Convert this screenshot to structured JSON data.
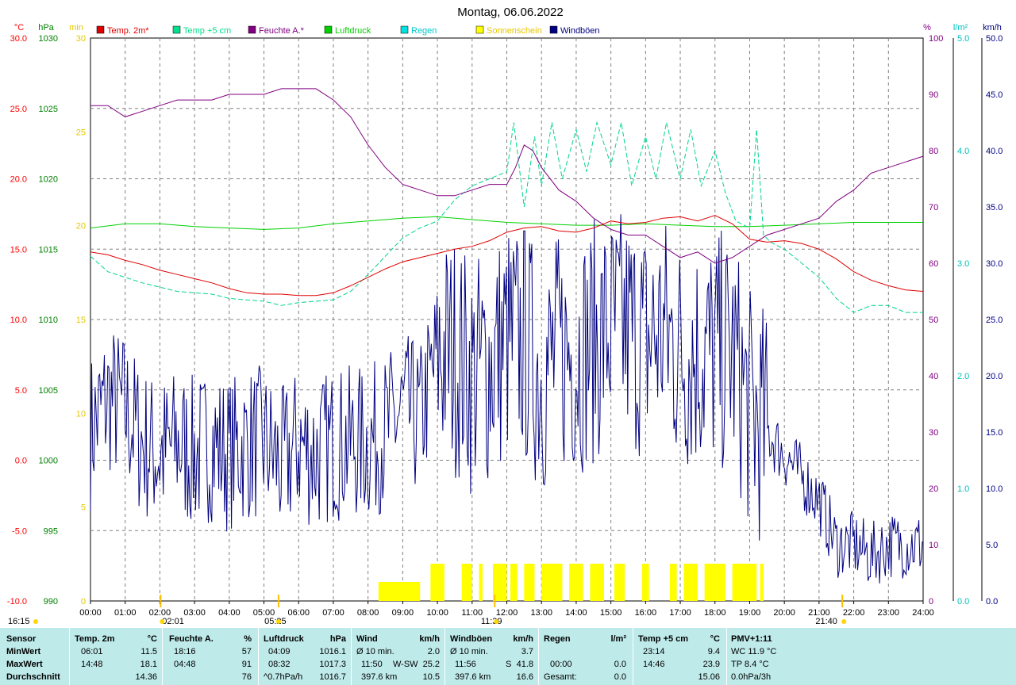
{
  "chart_data": {
    "type": "line",
    "title": "Montag, 06.06.2022",
    "x": {
      "min": 0,
      "max": 24,
      "ticks": [
        "00:00",
        "01:00",
        "02:00",
        "03:00",
        "04:00",
        "05:00",
        "06:00",
        "07:00",
        "08:00",
        "09:00",
        "10:00",
        "11:00",
        "12:00",
        "13:00",
        "14:00",
        "15:00",
        "16:00",
        "17:00",
        "18:00",
        "19:00",
        "20:00",
        "21:00",
        "22:00",
        "23:00",
        "24:00"
      ]
    },
    "axes": {
      "temp": {
        "unit": "°C",
        "min": -10,
        "max": 30,
        "ticks": [
          "-10.0",
          "-5.0",
          "0.0",
          "5.0",
          "10.0",
          "15.0",
          "20.0",
          "25.0",
          "30.0"
        ],
        "color": "#ff0000"
      },
      "pressure": {
        "unit": "hPa",
        "min": 990,
        "max": 1030,
        "ticks": [
          "990",
          "995",
          "1000",
          "1005",
          "1010",
          "1015",
          "1020",
          "1025",
          "1030"
        ],
        "color": "#008000"
      },
      "sunmin": {
        "unit": "min",
        "min": 0,
        "max": 30,
        "ticks": [
          "0",
          "5",
          "10",
          "15",
          "20",
          "25",
          "30"
        ],
        "color": "#e6c800"
      },
      "humidity": {
        "unit": "%",
        "min": 0,
        "max": 100,
        "ticks": [
          "0",
          "10",
          "20",
          "30",
          "40",
          "50",
          "60",
          "70",
          "80",
          "90",
          "100"
        ],
        "color": "#800080"
      },
      "rain": {
        "unit": "l/m²",
        "min": 0,
        "max": 5,
        "ticks": [
          "0.0",
          "1.0",
          "2.0",
          "3.0",
          "4.0",
          "5.0"
        ],
        "color": "#00c0c0"
      },
      "wind": {
        "unit": "km/h",
        "min": 0,
        "max": 50,
        "ticks": [
          "0.0",
          "5.0",
          "10.0",
          "15.0",
          "20.0",
          "25.0",
          "30.0",
          "35.0",
          "40.0",
          "45.0",
          "50.0"
        ],
        "color": "#000080"
      }
    },
    "legend": [
      {
        "name": "Temp. 2m*",
        "color": "#e00000"
      },
      {
        "name": "Temp +5 cm",
        "color": "#00e08c"
      },
      {
        "name": "Feuchte A.*",
        "color": "#800080"
      },
      {
        "name": "Luftdruck",
        "color": "#00d000"
      },
      {
        "name": "Regen",
        "color": "#00e0e0"
      },
      {
        "name": "Sonnenschein",
        "color": "#ffff00"
      },
      {
        "name": "Windböen",
        "color": "#000080"
      }
    ],
    "grid": true,
    "series": [
      {
        "name": "Temp. 2m*",
        "axis": "temp",
        "color": "#e00000",
        "x": [
          0,
          0.5,
          1,
          1.5,
          2,
          2.5,
          3,
          3.5,
          4,
          4.5,
          5,
          5.5,
          6,
          6.5,
          7,
          7.5,
          8,
          8.5,
          9,
          9.5,
          10,
          10.5,
          11,
          11.5,
          12,
          12.5,
          13,
          13.5,
          14,
          14.5,
          15,
          15.5,
          16,
          16.5,
          17,
          17.5,
          18,
          18.5,
          19,
          19.5,
          20,
          20.5,
          21,
          21.5,
          22,
          22.5,
          23,
          23.5,
          24
        ],
        "y": [
          14.8,
          14.6,
          14.2,
          13.9,
          13.5,
          13.2,
          12.9,
          12.6,
          12.2,
          11.9,
          11.8,
          11.8,
          11.7,
          11.7,
          11.9,
          12.4,
          13.0,
          13.6,
          14.1,
          14.4,
          14.7,
          15.0,
          15.2,
          15.6,
          16.2,
          16.5,
          16.6,
          16.3,
          16.2,
          16.5,
          17.0,
          16.8,
          16.9,
          17.2,
          17.3,
          17.0,
          17.4,
          16.8,
          15.7,
          15.5,
          15.6,
          15.4,
          15.0,
          14.3,
          13.4,
          12.8,
          12.4,
          12.1,
          12.0
        ]
      },
      {
        "name": "Temp +5 cm",
        "axis": "temp",
        "color": "#00d48c",
        "dashed": true,
        "x": [
          0,
          0.5,
          1,
          1.5,
          2,
          2.5,
          3,
          3.5,
          4,
          4.5,
          5,
          5.5,
          6,
          6.5,
          7,
          7.5,
          8,
          8.5,
          9,
          9.5,
          10,
          10.5,
          11,
          11.5,
          12,
          12.2,
          12.5,
          12.8,
          13,
          13.3,
          13.6,
          14,
          14.3,
          14.6,
          15,
          15.3,
          15.6,
          16,
          16.3,
          16.6,
          17,
          17.3,
          17.6,
          18,
          18.3,
          18.6,
          19,
          19.2,
          19.4,
          19.6,
          20,
          20.5,
          21,
          21.5,
          22,
          22.5,
          23,
          23.5,
          24
        ],
        "y": [
          14.5,
          13.4,
          13.0,
          12.6,
          12.3,
          12.0,
          11.9,
          11.8,
          11.5,
          11.4,
          11.3,
          11.0,
          11.2,
          11.3,
          11.4,
          12.0,
          13.2,
          14.5,
          15.8,
          16.5,
          17.0,
          18.5,
          19.5,
          20.0,
          20.5,
          24.0,
          18.0,
          23.0,
          19.5,
          24.0,
          20.0,
          23.5,
          20.5,
          24.0,
          21.0,
          24.0,
          19.5,
          23.0,
          20.0,
          24.0,
          20.0,
          23.5,
          19.5,
          22.0,
          19.0,
          17.0,
          16.5,
          23.5,
          16.0,
          15.5,
          15.0,
          14.0,
          13.0,
          11.5,
          10.5,
          11.0,
          11.0,
          10.5,
          10.5
        ]
      },
      {
        "name": "Feuchte A.*",
        "axis": "humidity",
        "color": "#800080",
        "x": [
          0,
          0.5,
          1,
          1.5,
          2,
          2.5,
          3,
          3.5,
          4,
          4.5,
          5,
          5.5,
          6,
          6.5,
          7,
          7.5,
          8,
          8.5,
          9,
          9.5,
          10,
          10.5,
          11,
          11.5,
          12,
          12.25,
          12.5,
          12.75,
          13,
          13.5,
          14,
          14.5,
          15,
          15.5,
          16,
          16.5,
          17,
          17.5,
          18,
          18.5,
          19,
          19.5,
          20,
          20.5,
          21,
          21.5,
          22,
          22.5,
          23,
          23.5,
          24
        ],
        "y": [
          88,
          88,
          86,
          87,
          88,
          89,
          89,
          89,
          90,
          90,
          90,
          91,
          91,
          91,
          89,
          86,
          81,
          77,
          74,
          73,
          72,
          72,
          73,
          74,
          74,
          77,
          81,
          80,
          77,
          73,
          71,
          68,
          66,
          65,
          65,
          63,
          61,
          62,
          60,
          61,
          63,
          65,
          66,
          67,
          68,
          71,
          73,
          76,
          77,
          78,
          79
        ]
      },
      {
        "name": "Luftdruck",
        "axis": "pressure",
        "color": "#00d000",
        "x": [
          0,
          1,
          2,
          3,
          4,
          5,
          6,
          7,
          8,
          9,
          10,
          11,
          12,
          13,
          14,
          15,
          16,
          17,
          18,
          19,
          20,
          21,
          22,
          23,
          24
        ],
        "y": [
          1016.5,
          1016.8,
          1016.8,
          1016.6,
          1016.5,
          1016.4,
          1016.5,
          1016.8,
          1017.0,
          1017.2,
          1017.3,
          1017.1,
          1016.9,
          1016.8,
          1016.7,
          1016.7,
          1016.8,
          1016.7,
          1016.6,
          1016.6,
          1016.7,
          1016.8,
          1016.9,
          1016.9,
          1016.9
        ]
      },
      {
        "name": "Windböen",
        "axis": "wind",
        "color": "#000080",
        "noisy": true,
        "x": [
          0,
          0.5,
          1,
          1.5,
          2,
          2.5,
          3,
          3.5,
          4,
          4.5,
          5,
          5.5,
          6,
          6.5,
          7,
          7.5,
          8,
          8.5,
          9,
          9.5,
          10,
          10.5,
          11,
          11.5,
          12,
          12.5,
          13,
          13.5,
          14,
          14.5,
          15,
          15.5,
          16,
          16.5,
          17,
          17.5,
          18,
          18.5,
          19,
          19.5,
          20,
          20.5,
          21,
          21.5,
          22,
          22.5,
          23,
          23.5,
          24
        ],
        "y": [
          15,
          18,
          17,
          14,
          13,
          14,
          13,
          14,
          13,
          14,
          14,
          12,
          14,
          13,
          14,
          14,
          14,
          15,
          17,
          16,
          22,
          22,
          20,
          21,
          23,
          23,
          20,
          22,
          22,
          23,
          24,
          24,
          23,
          24,
          22,
          22,
          22,
          22,
          17,
          15,
          13,
          11,
          9,
          5,
          5,
          4,
          5,
          5,
          5
        ]
      }
    ],
    "sunshine_segments": [
      [
        8.3,
        9.5
      ],
      [
        9.8,
        10.2
      ],
      [
        10.7,
        11.0
      ],
      [
        11.2,
        11.3
      ],
      [
        11.6,
        12.0
      ],
      [
        12.1,
        12.3
      ],
      [
        12.5,
        12.8
      ],
      [
        13.0,
        13.6
      ],
      [
        13.8,
        14.2
      ],
      [
        14.4,
        14.8
      ],
      [
        15.1,
        15.4
      ],
      [
        15.9,
        16.1
      ],
      [
        16.7,
        16.9
      ],
      [
        17.1,
        17.5
      ],
      [
        17.7,
        18.3
      ],
      [
        18.5,
        19.2
      ],
      [
        19.3,
        19.4
      ]
    ],
    "annotations": [
      {
        "label": "02:01",
        "x": 2.02
      },
      {
        "label": "05:25",
        "x": 5.42
      },
      {
        "label": "11:39",
        "x": 11.65
      },
      {
        "label": "16:15",
        "x": null
      },
      {
        "label": "21:40",
        "x": 21.67
      }
    ]
  },
  "stats": {
    "row_labels": [
      "Sensor",
      "MinWert",
      "MaxWert",
      "Durchschnitt"
    ],
    "temp2m": {
      "title": "Temp. 2m",
      "unit": "°C",
      "min_time": "06:01",
      "min": "11.5",
      "max_time": "14:48",
      "max": "18.1",
      "avg": "14.36"
    },
    "humidity": {
      "title": "Feuchte A.",
      "unit": "%",
      "min_time": "18:16",
      "min": "57",
      "max_time": "04:48",
      "max": "91",
      "avg": "76"
    },
    "pressure": {
      "title": "Luftdruck",
      "unit": "hPa",
      "min_time": "04:09",
      "min": "1016.1",
      "max_time": "08:32",
      "max": "1017.3",
      "trend": "^0.7hPa/h",
      "avg": "1016.7"
    },
    "wind": {
      "title": "Wind",
      "unit": "km/h",
      "min_label": "Ø 10 min.",
      "min": "2.0",
      "max_time": "11:50",
      "max_dir": "W-SW",
      "max": "25.2",
      "km": "397.6 km",
      "avg": "10.5"
    },
    "gust": {
      "title": "Windböen",
      "unit": "km/h",
      "min_label": "Ø 10 min.",
      "min": "3.7",
      "max_time": "11:56",
      "max_dir": "S",
      "max": "41.8",
      "km": "397.6 km",
      "avg": "16.6"
    },
    "rain": {
      "title": "Regen",
      "unit": "l/m²",
      "max_time": "00:00",
      "max": "0.0",
      "total_label": "Gesamt:",
      "total": "0.0"
    },
    "temp5": {
      "title": "Temp +5 cm",
      "unit": "°C",
      "min_time": "23:14",
      "min": "9.4",
      "max_time": "14:46",
      "max": "23.9",
      "avg": "15.06"
    },
    "pmv": {
      "title": "PMV+1:11",
      "wc": "WC 11.9 °C",
      "tp": "TP 8.4 °C",
      "trend": "0.0hPa/3h"
    }
  }
}
